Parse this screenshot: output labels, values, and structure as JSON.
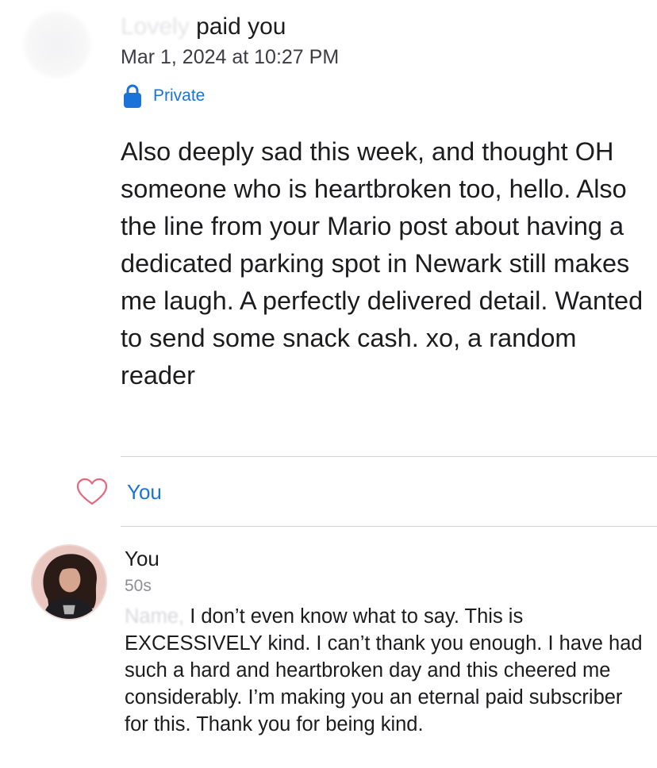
{
  "payment": {
    "title_redacted": "Lovely",
    "title_suffix": "paid you",
    "date": "Mar 1, 2024 at 10:27 PM",
    "privacy": "Private",
    "message": "Also deeply sad this week, and thought OH someone who is heartbroken too, hello. Also the line from your Mario post about having a dedicated parking spot in Newark still makes me laugh. A perfectly delivered detail. Wanted to send some snack cash. xo, a random reader"
  },
  "likes": {
    "icon": "heart-outline-icon",
    "label": "You",
    "color": "#e8657a"
  },
  "reply": {
    "author": "You",
    "time": "50s",
    "name_redacted": "Name,",
    "text": " I don’t even know what to say. This is EXCESSIVELY kind. I can’t thank you enough. I have had such a hard and heartbroken day and this cheered me considerably. I’m making you an eternal paid subscriber for this. Thank you for being kind."
  },
  "colors": {
    "link_blue": "#1a73d9",
    "divider": "#d1d1d6",
    "text": "#1c1c1e",
    "secondary": "#8e8e93"
  }
}
